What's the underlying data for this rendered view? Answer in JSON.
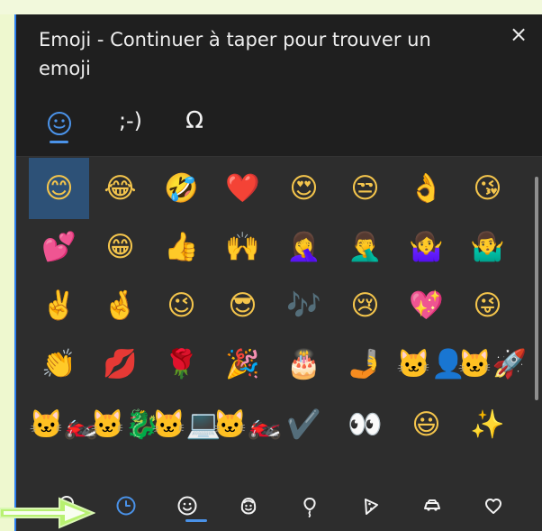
{
  "window": {
    "title": "Emoji - Continuer à taper pour trouver un emoji",
    "close_label": "×"
  },
  "tabs": [
    {
      "label": "☺",
      "icon": "emoji-smile-icon",
      "active": true
    },
    {
      "label": ";-)",
      "icon": "kaomoji-tab-icon",
      "active": false
    },
    {
      "label": "Ω",
      "icon": "symbols-tab-icon",
      "active": false
    }
  ],
  "emoji_grid": {
    "rows": [
      [
        "😊",
        "😂",
        "🤣",
        "❤️",
        "😍",
        "😒",
        "👌",
        "😘"
      ],
      [
        "💕",
        "😁",
        "👍",
        "🙌",
        "🤦‍♀️",
        "🤦‍♂️",
        "🤷‍♀️",
        "🤷‍♂️"
      ],
      [
        "✌️",
        "🤞",
        "😉",
        "😎",
        "🎶",
        "😢",
        "💖",
        "😜"
      ],
      [
        "👏",
        "💋",
        "🌹",
        "🎉",
        "🎂",
        "🤳",
        "🐱‍👤",
        "🐱‍🚀"
      ],
      [
        "🐱‍🏍",
        "🐱‍🐉",
        "🐱‍💻",
        "🐱‍🏍",
        "✔️",
        "👀",
        "😃",
        "✨"
      ]
    ]
  },
  "bottom_nav": [
    {
      "label": "Rechercher",
      "icon": "search-icon",
      "active": false
    },
    {
      "label": "Récents",
      "icon": "clock-icon",
      "active": true
    },
    {
      "label": "Visages",
      "icon": "smiley-icon",
      "active": false
    },
    {
      "label": "Personnes",
      "icon": "person-face-icon",
      "active": false
    },
    {
      "label": "Célébrations",
      "icon": "balloon-icon",
      "active": false
    },
    {
      "label": "Nourriture",
      "icon": "pizza-icon",
      "active": false
    },
    {
      "label": "Transport",
      "icon": "car-icon",
      "active": false
    },
    {
      "label": "Cœurs",
      "icon": "heart-icon",
      "active": false
    }
  ],
  "colors": {
    "panel_bg": "#2d2d2d",
    "header_bg": "#1f1f1f",
    "accent": "#4a92e8",
    "selection": "#2d5177",
    "outer_bg": "#eef8cf",
    "arrow": "#b8f171"
  }
}
